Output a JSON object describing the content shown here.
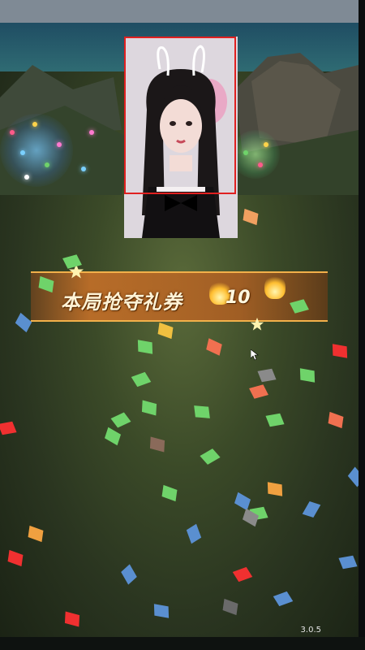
{
  "game": {
    "banner_text": "本局抢夺礼券",
    "banner_count": "10"
  },
  "app": {
    "version": "3.0.5"
  },
  "colors": {
    "banner_gold": "#f2b04a",
    "video_frame_red": "#e02020"
  }
}
